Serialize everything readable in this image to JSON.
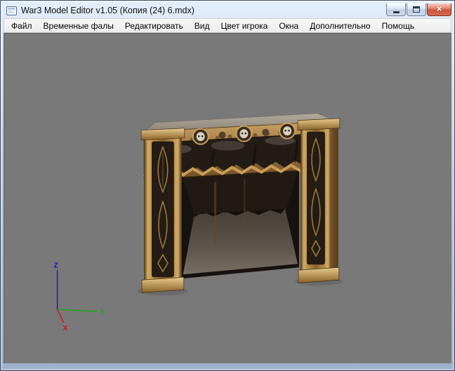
{
  "window": {
    "title": "War3 Model Editor v1.05 (Копия (24) 6.mdx)",
    "controls": {
      "close_glyph": "×"
    }
  },
  "menu": {
    "items": [
      {
        "label": "Файл"
      },
      {
        "label": "Временные фалы"
      },
      {
        "label": "Редактировать"
      },
      {
        "label": "Вид"
      },
      {
        "label": "Цвет игрока"
      },
      {
        "label": "Окна"
      },
      {
        "label": "Дополнительно"
      },
      {
        "label": "Помощь"
      }
    ]
  },
  "viewport": {
    "background_color": "#797979",
    "axes": {
      "x": "X",
      "y": "Y",
      "z": "Z"
    },
    "axis_colors": {
      "x": "#cc1111",
      "y": "#11aa11",
      "z": "#1111cc"
    }
  }
}
